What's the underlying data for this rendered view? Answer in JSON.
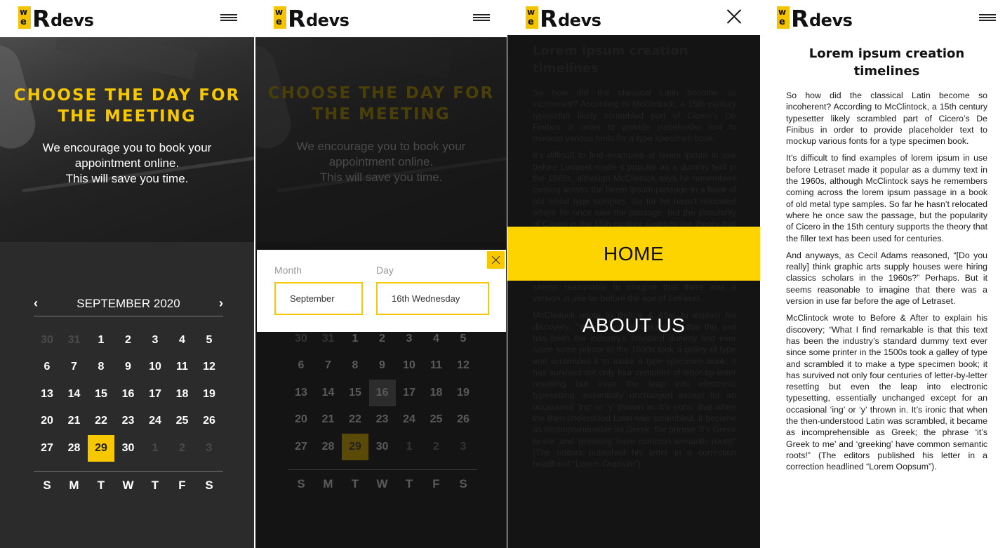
{
  "brand": {
    "logo_w": "w",
    "logo_e": "e",
    "logo_R": "R",
    "logo_devs": "devs"
  },
  "colors": {
    "accent": "#f7c800",
    "dark": "#2b2b2b",
    "overlay": "#141414"
  },
  "hero": {
    "title_line1": "CHOOSE THE DAY FOR",
    "title_line2": "THE MEETING",
    "sub_line1": "We encourage you to book your",
    "sub_line2": "appointment online.",
    "sub_line3": "This will save you time."
  },
  "calendar": {
    "prev": "‹",
    "next": "›",
    "month_label": "SEPTEMBER 2020",
    "weeks": [
      [
        "30",
        "31",
        "1",
        "2",
        "3",
        "4",
        "5"
      ],
      [
        "6",
        "7",
        "8",
        "9",
        "10",
        "11",
        "12"
      ],
      [
        "13",
        "14",
        "15",
        "16",
        "17",
        "18",
        "19"
      ],
      [
        "20",
        "21",
        "22",
        "23",
        "24",
        "25",
        "26"
      ],
      [
        "27",
        "28",
        "29",
        "30",
        "1",
        "2",
        "3"
      ]
    ],
    "muted": [
      [
        0,
        0
      ],
      [
        0,
        1
      ],
      [
        4,
        4
      ],
      [
        4,
        5
      ],
      [
        4,
        6
      ]
    ],
    "selected": [
      4,
      2
    ],
    "weekdays": [
      "S",
      "M",
      "T",
      "W",
      "T",
      "F",
      "S"
    ]
  },
  "picker": {
    "month_label": "Month",
    "day_label": "Day",
    "month_value": "September",
    "day_value": "16th Wednesday",
    "hovered": [
      2,
      3
    ]
  },
  "menu": {
    "home": "HOME",
    "about": "ABOUT US"
  },
  "article": {
    "title_line1": "Lorem ipsum creation",
    "title_line2": "timelines",
    "paragraphs": [
      "So how did the classical Latin become so incoherent? According to McClintock, a 15th century typesetter likely scrambled part of Cicero’s De Finibus in order to provide placeholder text to mockup various fonts for a type specimen book.",
      "It’s difficult to find examples of lorem ipsum in use before Letraset made it popular as a dummy text in the 1960s, although McClintock says he remembers coming across the lorem ipsum passage in a book of old metal type samples. So far he hasn’t relocated where he once saw the passage, but the popularity of Cicero in the 15th century supports the theory that the filler text has been used for centuries.",
      "And anyways, as Cecil Adams reasoned, “[Do you really] think graphic arts supply houses were hiring classics scholars in the 1960s?” Perhaps. But it seems reasonable to imagine that there was a version in use far before the age of Letraset.",
      "McClintock wrote to Before & After to explain his discovery; “What I find remarkable is that this text has been the industry’s standard dummy text ever since some printer in the 1500s took a galley of type and scrambled it to make a type specimen book; it has survived not only four centuries of letter-by-letter resetting but even the leap into electronic typesetting, essentially unchanged except for an occasional ‘ing’ or ‘y’ thrown in. It’s ironic that when the then-understood Latin was scrambled, it became as incomprehensible as Greek; the phrase ‘it’s Greek to me’ and ‘greeking’ have common semantic roots!” (The editors published his letter in a correction headlined “Lorem Oopsum”)."
    ]
  }
}
